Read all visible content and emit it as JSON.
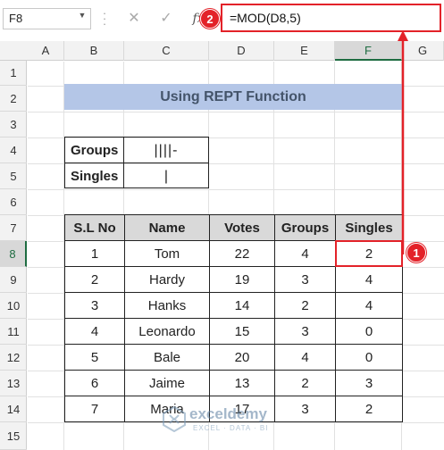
{
  "formula_bar": {
    "name_box": "F8",
    "fx_label": "fx",
    "formula": "=MOD(D8,5)",
    "badge_formula": "2"
  },
  "columns": [
    "A",
    "B",
    "C",
    "D",
    "E",
    "F",
    "G"
  ],
  "rows": [
    "1",
    "2",
    "3",
    "4",
    "5",
    "6",
    "7",
    "8",
    "9",
    "10",
    "11",
    "12",
    "13",
    "14",
    "15"
  ],
  "title": "Using REPT Function",
  "summary": {
    "groups_label": "Groups",
    "groups_value": "||||-",
    "singles_label": "Singles",
    "singles_value": "|"
  },
  "table": {
    "headers": [
      "S.L No",
      "Name",
      "Votes",
      "Groups",
      "Singles"
    ],
    "rows": [
      [
        "1",
        "Tom",
        "22",
        "4",
        "2"
      ],
      [
        "2",
        "Hardy",
        "19",
        "3",
        "4"
      ],
      [
        "3",
        "Hanks",
        "14",
        "2",
        "4"
      ],
      [
        "4",
        "Leonardo",
        "15",
        "3",
        "0"
      ],
      [
        "5",
        "Bale",
        "20",
        "4",
        "0"
      ],
      [
        "6",
        "Jaime",
        "13",
        "2",
        "3"
      ],
      [
        "7",
        "Maria",
        "17",
        "3",
        "2"
      ]
    ]
  },
  "badge_cell": "1",
  "selected_cell": "F8",
  "watermark": {
    "name": "exceldemy",
    "tagline": "EXCEL · DATA · BI"
  },
  "colors": {
    "accent_red": "#e32229",
    "title_fill": "#b4c6e7",
    "header_fill": "#d9d9d9",
    "excel_green": "#1e6c41"
  }
}
